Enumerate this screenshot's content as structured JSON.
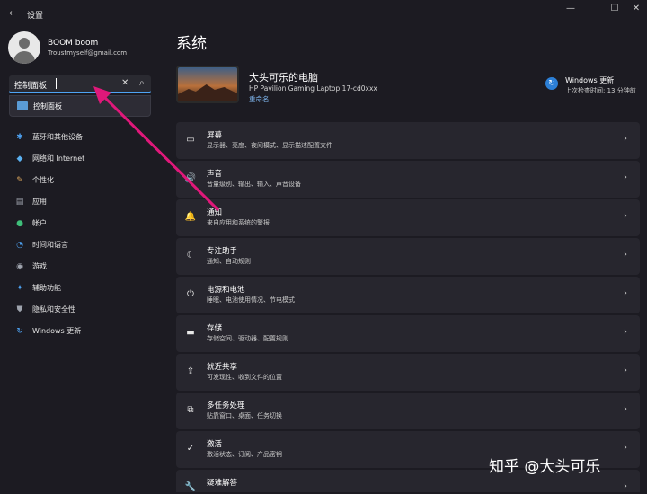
{
  "window": {
    "back": "←",
    "title": "设置",
    "min": "—",
    "max": "☐",
    "close": "✕"
  },
  "user": {
    "name": "BOOM boom",
    "email": "Troustmyself@gmail.com"
  },
  "search": {
    "value": "控制面板",
    "clear": "✕",
    "glass": "⌕"
  },
  "suggestion": {
    "label": "控制面板"
  },
  "sidebar": {
    "items": [
      {
        "icon": "✱",
        "color": "#4ea4f5",
        "label": "蓝牙和其他设备"
      },
      {
        "icon": "◆",
        "color": "#5ab0f0",
        "label": "网络和 Internet"
      },
      {
        "icon": "✎",
        "color": "#d8a35b",
        "label": "个性化"
      },
      {
        "icon": "▤",
        "color": "#9ea3ad",
        "label": "应用"
      },
      {
        "icon": "●",
        "color": "#3fbf7a",
        "label": "帐户"
      },
      {
        "icon": "◔",
        "color": "#4ea4f5",
        "label": "时间和语言"
      },
      {
        "icon": "◉",
        "color": "#9ea3ad",
        "label": "游戏"
      },
      {
        "icon": "✦",
        "color": "#4ea4f5",
        "label": "辅助功能"
      },
      {
        "icon": "⛊",
        "color": "#9ea3ad",
        "label": "隐私和安全性"
      },
      {
        "icon": "↻",
        "color": "#4ea4f5",
        "label": "Windows 更新"
      }
    ]
  },
  "main": {
    "title": "系统",
    "device": {
      "name": "大头可乐的电脑",
      "model": "HP Pavilion Gaming Laptop 17-cd0xxx",
      "rename": "重命名"
    },
    "update": {
      "icon": "↻",
      "title": "Windows 更新",
      "subtitle": "上次检查时间: 13 分钟前"
    },
    "cards": [
      {
        "icon": "▭",
        "title": "屏幕",
        "subtitle": "显示器、亮度、夜间模式、显示描述配置文件"
      },
      {
        "icon": "🔊",
        "title": "声音",
        "subtitle": "音量级别、输出、输入、声音设备"
      },
      {
        "icon": "🔔",
        "title": "通知",
        "subtitle": "来自应用和系统的警报"
      },
      {
        "icon": "☾",
        "title": "专注助手",
        "subtitle": "通知、自动规则"
      },
      {
        "icon": "⏻",
        "title": "电源和电池",
        "subtitle": "睡眠、电池使用情况、节电模式"
      },
      {
        "icon": "▬",
        "title": "存储",
        "subtitle": "存储空间、驱动器、配置规则"
      },
      {
        "icon": "⇪",
        "title": "就近共享",
        "subtitle": "可发现性、收到文件的位置"
      },
      {
        "icon": "⧉",
        "title": "多任务处理",
        "subtitle": "贴靠窗口、桌面、任务切换"
      },
      {
        "icon": "✓",
        "title": "激活",
        "subtitle": "激活状态、订阅、产品密钥"
      },
      {
        "icon": "🔧",
        "title": "疑难解答",
        "subtitle": ""
      }
    ],
    "chevron": "›"
  },
  "watermark": "知乎 @大头可乐",
  "colors": {
    "accent": "#4ea4f5",
    "annotation_arrow": "#e0187a"
  }
}
